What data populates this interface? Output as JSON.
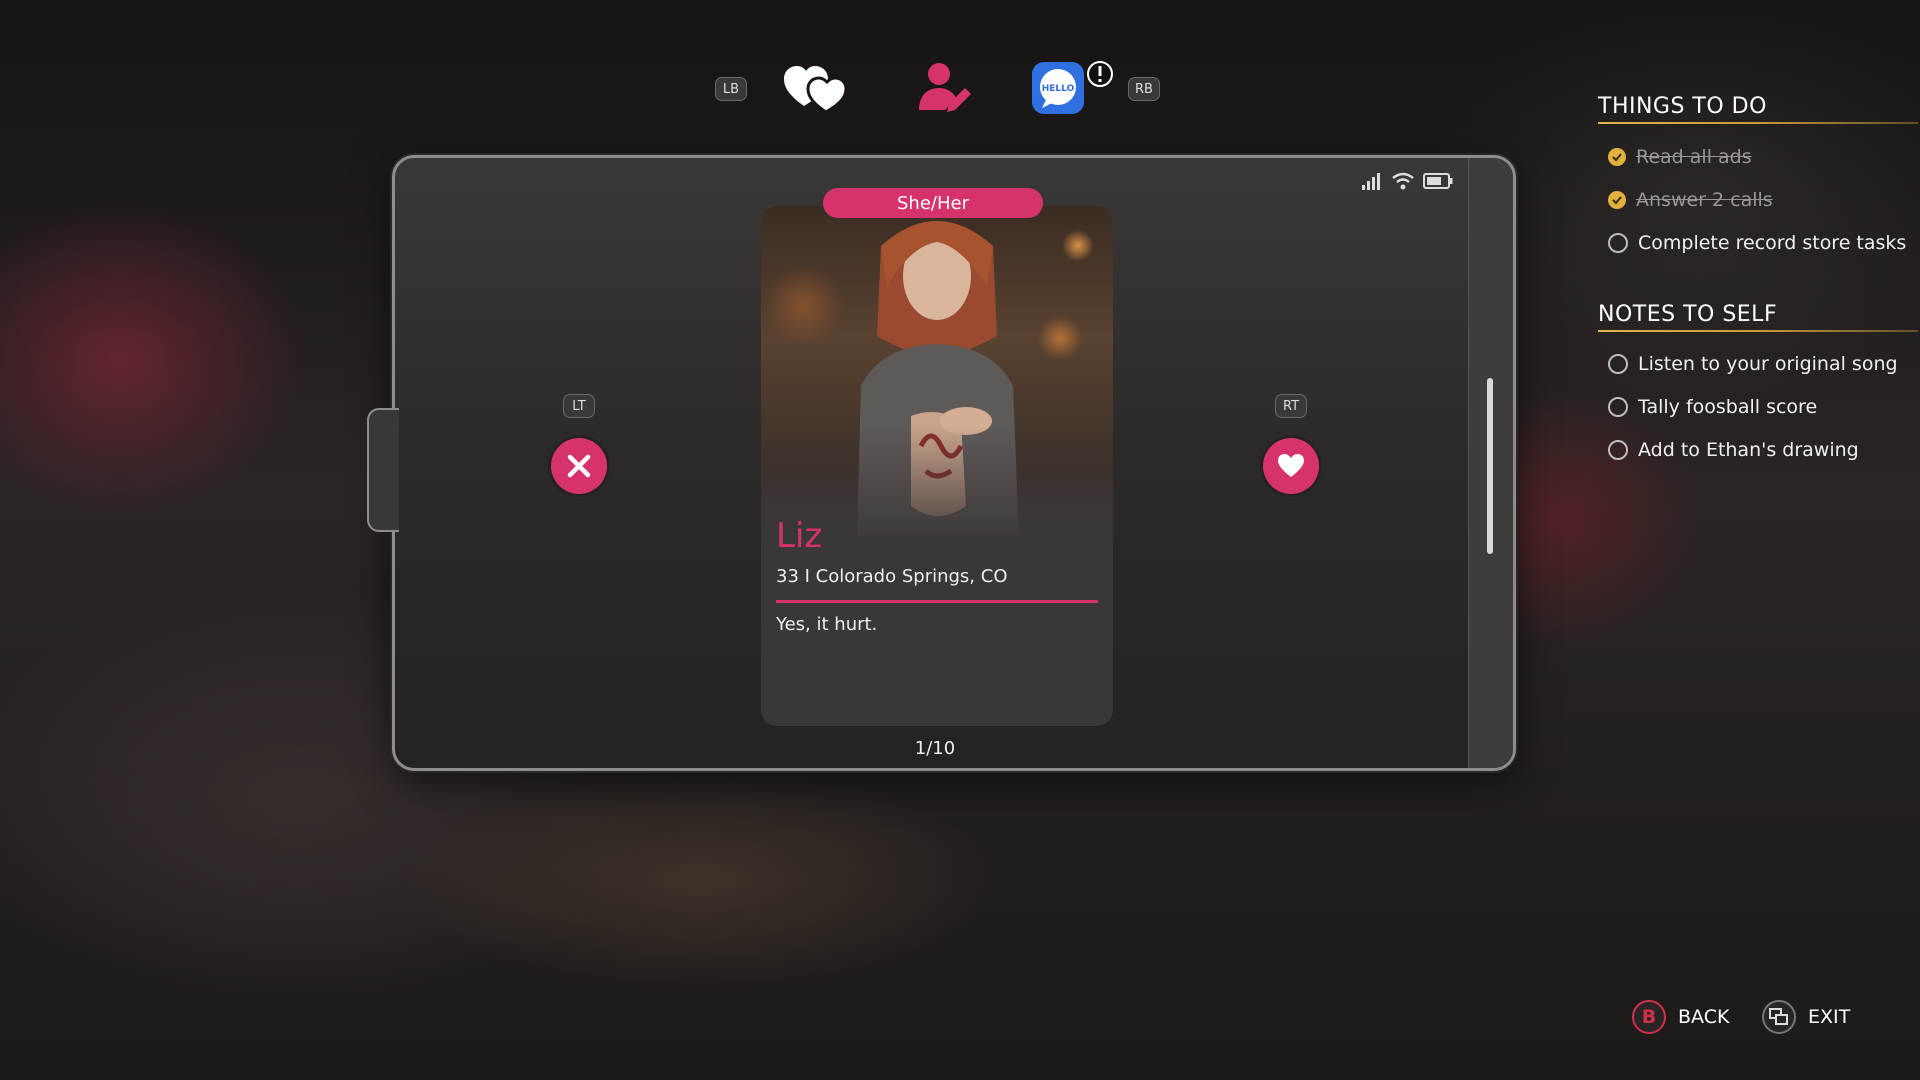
{
  "top_bar": {
    "left_bumper": "LB",
    "right_bumper": "RB",
    "tabs": [
      {
        "icon": "hearts-icon"
      },
      {
        "icon": "profile-edit-icon"
      },
      {
        "icon": "hello-chat-icon",
        "badge_icon": "alert-icon"
      }
    ]
  },
  "phone": {
    "status_icons": [
      "signal-icon",
      "wifi-icon",
      "battery-icon"
    ],
    "left_trigger": "LT",
    "right_trigger": "RT",
    "reject_icon": "close-icon",
    "like_icon": "heart-icon",
    "profile": {
      "pronouns": "She/Her",
      "name": "Liz",
      "age_location": "33 I Colorado Springs, CO",
      "bio": "Yes, it hurt."
    },
    "counter": "1/10"
  },
  "things_to_do": {
    "title": "THINGS TO DO",
    "items": [
      {
        "label": "Read all ads",
        "done": true
      },
      {
        "label": "Answer 2 calls",
        "done": true
      },
      {
        "label": "Complete record store tasks",
        "done": false
      }
    ]
  },
  "notes_to_self": {
    "title": "NOTES TO SELF",
    "items": [
      {
        "label": "Listen to your original song",
        "done": false
      },
      {
        "label": "Tally foosball score",
        "done": false
      },
      {
        "label": "Add to Ethan's drawing",
        "done": false
      }
    ]
  },
  "footer": {
    "back_button": "B",
    "back_label": "BACK",
    "exit_label": "EXIT"
  },
  "colors": {
    "accent": "#d6336c",
    "check": "#e0b13c",
    "hello_blue": "#2f6fe0"
  }
}
